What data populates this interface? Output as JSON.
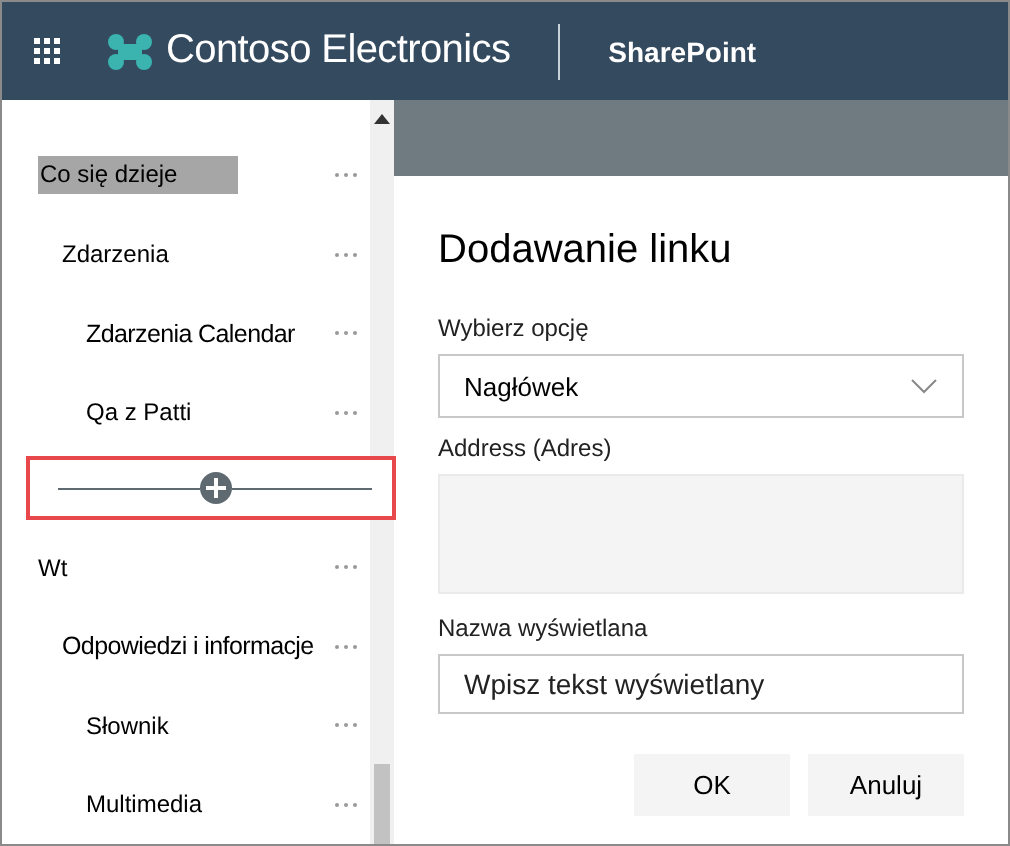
{
  "header": {
    "site_name": "Contoso Electronics",
    "app_name": "SharePoint"
  },
  "nav": {
    "items": [
      {
        "label": "Co się dzieje",
        "selected": true,
        "children": [
          {
            "label": "Zdarzenia",
            "selected": false,
            "children": [
              {
                "label": "Zdarzenia Calendar",
                "selected": false
              },
              {
                "label": "Qa z Patti",
                "selected": false
              }
            ]
          }
        ]
      },
      {
        "kind": "insert"
      },
      {
        "label": "Wt",
        "selected": false,
        "children": [
          {
            "label": "Odpowiedzi i informacje",
            "selected": false,
            "children": [
              {
                "label": "Słownik",
                "selected": false
              },
              {
                "label": "Multimedia",
                "selected": false
              }
            ]
          }
        ]
      }
    ]
  },
  "dialog": {
    "title": "Dodawanie linku",
    "option_label": "Wybierz opcję",
    "option_value": "Nagłówek",
    "address_label": "Address (Adres)",
    "display_label": "Nazwa wyświetlana",
    "display_placeholder": "Wpisz tekst wyświetlany",
    "buttons": [
      "OK",
      "Anuluj"
    ]
  }
}
